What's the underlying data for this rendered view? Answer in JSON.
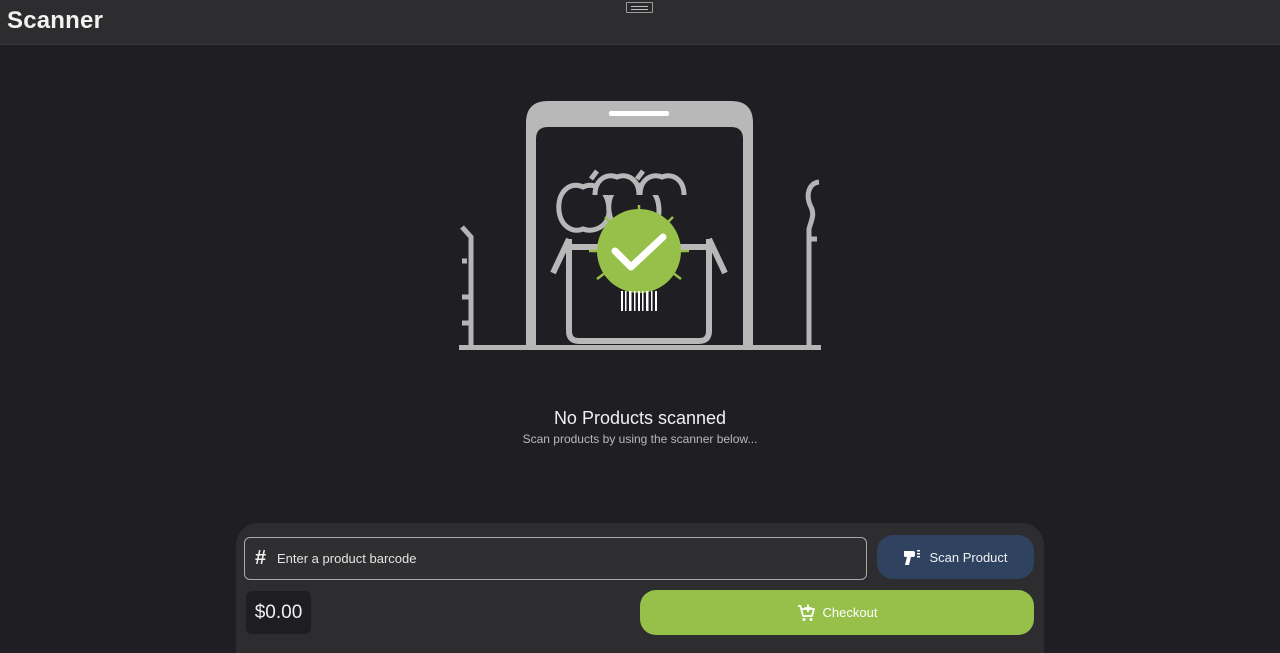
{
  "app": {
    "title": "Scanner"
  },
  "empty_state": {
    "title": "No Products scanned",
    "subtitle": "Scan products by using the scanner below..."
  },
  "scanner": {
    "barcode_placeholder": "Enter a product barcode",
    "barcode_value": "",
    "scan_button_label": "Scan Product"
  },
  "footer": {
    "total": "$0.00",
    "checkout_label": "Checkout"
  },
  "colors": {
    "background": "#1f1e23",
    "panel": "#2d2c2e",
    "accent_green": "#97c04b",
    "scan_button": "#2f4260"
  },
  "icons": {
    "hash": "hash-icon",
    "scanner": "barcode-scanner-icon",
    "cart": "add-to-cart-icon",
    "illustration": "phone-scan-success-illustration"
  }
}
